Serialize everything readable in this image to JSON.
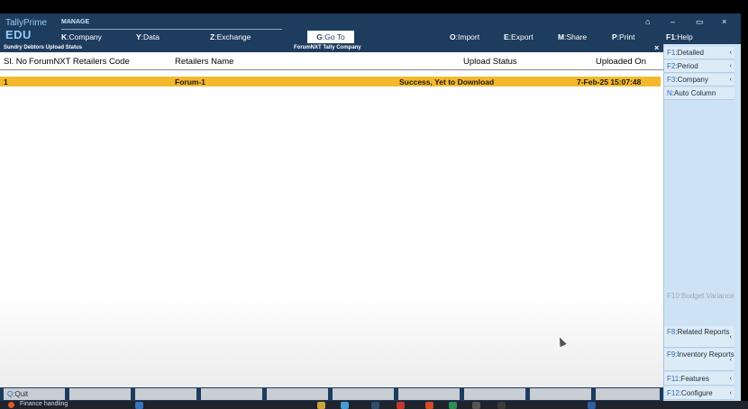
{
  "header": {
    "brand": "TallyPrime",
    "edition": "EDU",
    "section_label": "MANAGE",
    "menu": [
      {
        "key": "K",
        "label": "Company"
      },
      {
        "key": "Y",
        "label": "Data"
      },
      {
        "key": "Z",
        "label": "Exchange"
      }
    ],
    "goto": {
      "key": "G",
      "label": "Go To"
    },
    "actions": [
      {
        "key": "O",
        "label": "Import"
      },
      {
        "key": "E",
        "label": "Export"
      },
      {
        "key": "M",
        "label": "Share"
      },
      {
        "key": "P",
        "label": "Print"
      },
      {
        "key": "F1",
        "label": "Help"
      }
    ],
    "window_controls": [
      "⌂",
      "–",
      "▭",
      "×"
    ]
  },
  "report": {
    "title": "Sundry Debtors Upload Status",
    "company": "ForumNXT Tally Company",
    "close_glyph": "×",
    "columns": [
      "Sl. No",
      "ForumNXT Retailers Code",
      "Retailers Name",
      "Upload Status",
      "Uploaded On"
    ],
    "rows": [
      {
        "sl_no": "1",
        "code": "",
        "name": "Forum-1",
        "status": "Success, Yet to Download",
        "uploaded_on": "7-Feb-25 15:07:48"
      }
    ]
  },
  "right_panel": {
    "top_buttons": [
      {
        "key": "F1",
        "label": "Detailed",
        "arrow": "‹"
      },
      {
        "key": "F2",
        "label": "Period",
        "arrow": "‹"
      },
      {
        "key": "F3",
        "label": "Company",
        "arrow": "‹"
      },
      {
        "key": "N",
        "label": "Auto Column",
        "arrow": ""
      }
    ],
    "budget": {
      "key": "F10",
      "label": "Budget Variance"
    },
    "bottom_buttons": [
      {
        "key": "F8",
        "label": "Related Reports",
        "arrow": "‹"
      },
      {
        "key": "F9",
        "label": "Inventory Reports",
        "arrow": "‹"
      },
      {
        "key": "F11",
        "label": "Features",
        "arrow": "‹"
      },
      {
        "key": "F12",
        "label": "Configure",
        "arrow": "‹"
      }
    ]
  },
  "bottom_bar": {
    "quit": {
      "key": "Q",
      "label": "Quit"
    }
  },
  "taskbar": {
    "text": "Finance handling"
  },
  "colors": {
    "header_bg": "#1d3c5e",
    "highlight_row": "#f4b92b",
    "panel_bg": "#cde3f5",
    "key_blue": "#2b6fb3"
  }
}
